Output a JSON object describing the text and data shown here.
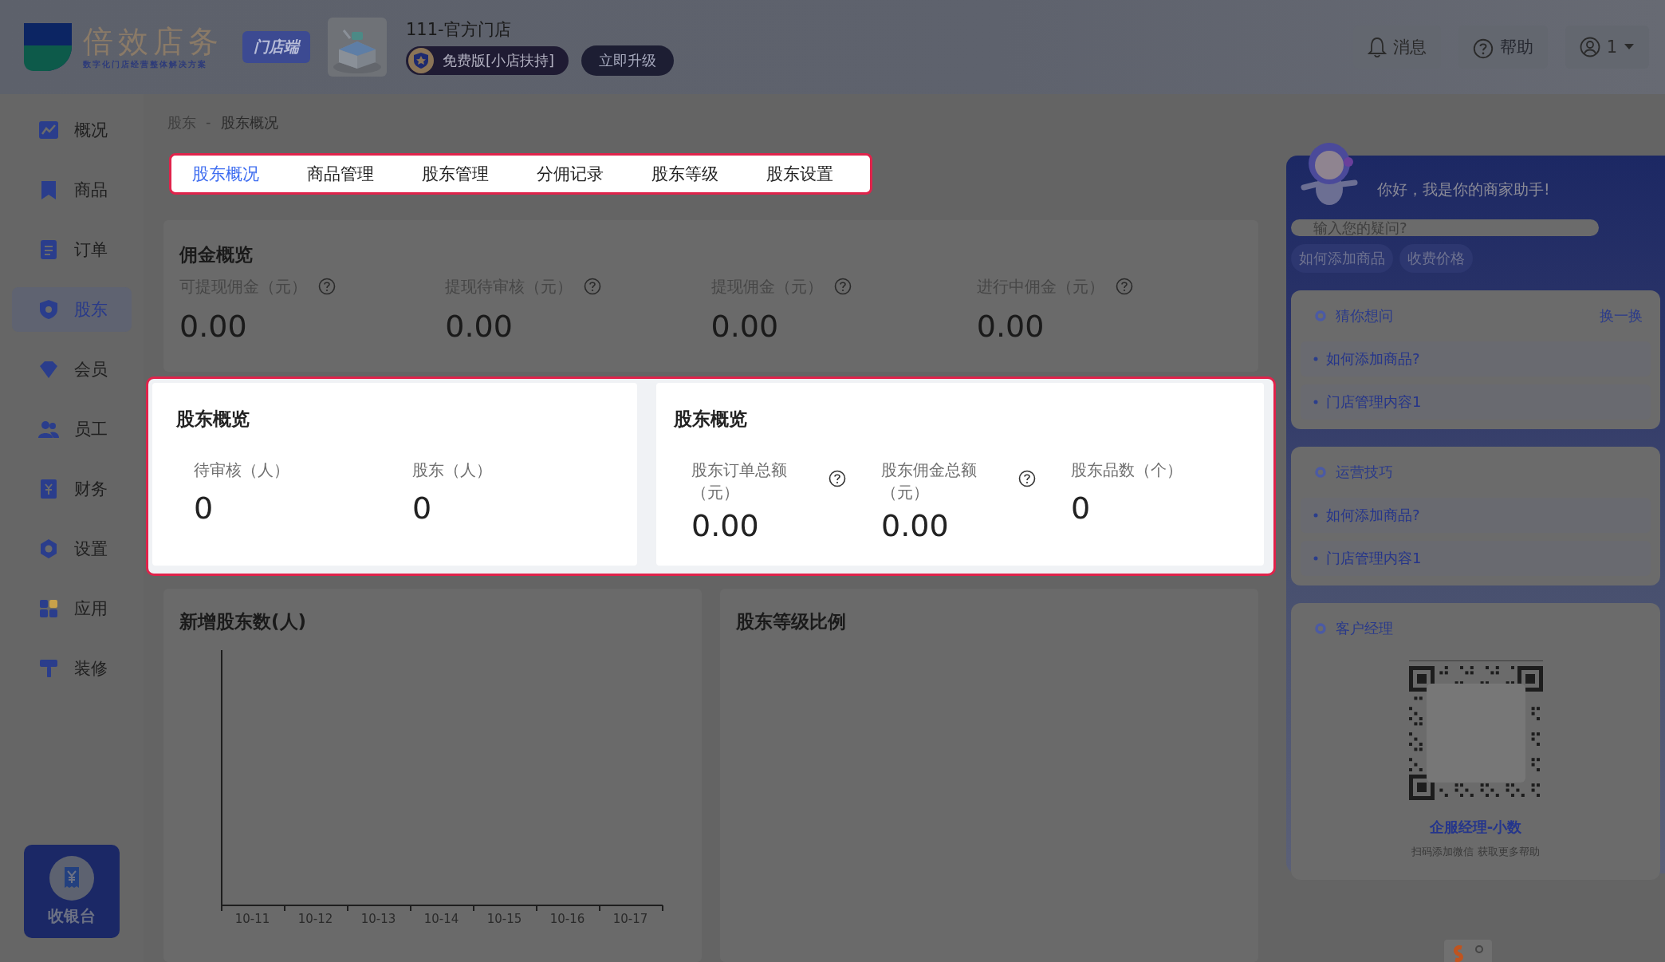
{
  "header": {
    "logo": {
      "name": "倍效店务",
      "tagline": "数字化门店经营整体解决方案"
    },
    "client_badge": "门店端",
    "store": {
      "name": "111-官方门店",
      "plan": "免费版[小店扶持]",
      "upgrade_button": "立即升级"
    },
    "actions": [
      {
        "kind": "bell",
        "label": "消息"
      },
      {
        "kind": "help",
        "label": "帮助"
      },
      {
        "kind": "user",
        "label": "1"
      }
    ]
  },
  "sidebar": {
    "items": [
      {
        "label": "概况",
        "selected": false
      },
      {
        "label": "商品",
        "selected": false
      },
      {
        "label": "订单",
        "selected": false
      },
      {
        "label": "股东",
        "selected": true
      },
      {
        "label": "会员",
        "selected": false
      },
      {
        "label": "员工",
        "selected": false
      },
      {
        "label": "财务",
        "selected": false
      },
      {
        "label": "设置",
        "selected": false
      },
      {
        "label": "应用",
        "selected": false
      },
      {
        "label": "装修",
        "selected": false
      }
    ],
    "cashier": {
      "label": "收银台"
    }
  },
  "breadcrumb": {
    "items": [
      "股东",
      "股东概况"
    ],
    "separator": "-"
  },
  "tabs": {
    "highlighted": true,
    "items": [
      {
        "label": "股东概况",
        "selected": true
      },
      {
        "label": "商品管理",
        "selected": false
      },
      {
        "label": "股东管理",
        "selected": false
      },
      {
        "label": "分佣记录",
        "selected": false
      },
      {
        "label": "股东等级",
        "selected": false
      },
      {
        "label": "股东设置",
        "selected": false
      }
    ]
  },
  "commission_overview": {
    "highlighted": false,
    "title": "佣金概览",
    "metrics": [
      {
        "label": "可提现佣金（元）",
        "value": "0.00",
        "help": true
      },
      {
        "label": "提现待审核（元）",
        "value": "0.00",
        "help": true
      },
      {
        "label": "提现佣金（元）",
        "value": "0.00",
        "help": true
      },
      {
        "label": "进行中佣金（元）",
        "value": "0.00",
        "help": true
      }
    ]
  },
  "shareholder_overview": {
    "highlighted": true,
    "cards": [
      {
        "title": "股东概览",
        "metrics": [
          {
            "label": "待审核（人）",
            "value": "0",
            "help": false
          },
          {
            "label": "股东（人）",
            "value": "0",
            "help": false
          }
        ]
      },
      {
        "title": "股东概览",
        "metrics": [
          {
            "label": "股东订单总额（元）",
            "value": "0.00",
            "help": true
          },
          {
            "label": "股东佣金总额（元）",
            "value": "0.00",
            "help": true
          },
          {
            "label": "股东品数（个）",
            "value": "0",
            "help": false
          }
        ]
      }
    ]
  },
  "new_shareholders_chart": {
    "title": "新增股东数(人)",
    "x_labels": [
      "10-11",
      "10-12",
      "10-13",
      "10-14",
      "10-15",
      "10-16",
      "10-17"
    ]
  },
  "level_ratio": {
    "title": "股东等级比例"
  },
  "assistant": {
    "greeting": "你好，我是你的商家助手!",
    "search": {
      "placeholder": "输入您的疑问?"
    },
    "quick_chips": [
      "如何添加商品",
      "收费价格"
    ],
    "sections": [
      {
        "title": "猜你想问",
        "action": "换一换",
        "items": [
          "如何添加商品?",
          "门店管理内容1"
        ]
      },
      {
        "title": "运营技巧",
        "items": [
          "如何添加商品?",
          "门店管理内容1"
        ]
      }
    ],
    "manager": {
      "title": "客户经理",
      "name": "企服经理-小数",
      "hint": "扫码添加微信 获取更多帮助"
    }
  }
}
